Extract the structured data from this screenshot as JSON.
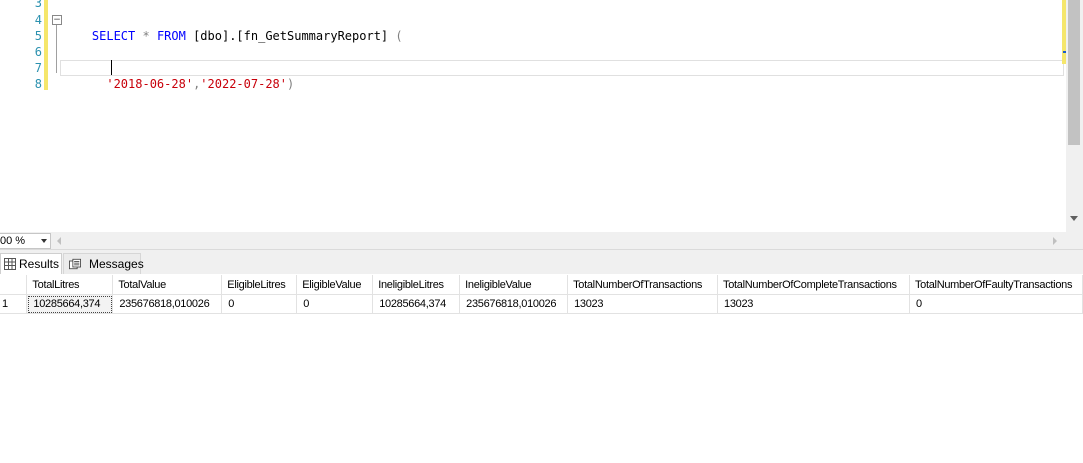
{
  "editor": {
    "line_numbers": [
      "3",
      "4",
      "5",
      "6",
      "7",
      "8"
    ],
    "collapse_glyph": "−",
    "line4": {
      "kw_select": "SELECT",
      "star": " * ",
      "kw_from": "FROM",
      "object": " [dbo].[fn_GetSummaryReport] ",
      "paren": "("
    },
    "line7": {
      "indent": "  ",
      "arg1": "'2018-06-28'",
      "comma": ",",
      "arg2": "'2022-07-28'",
      "close": ")"
    }
  },
  "zoom": {
    "value": "00 %"
  },
  "tabs": {
    "results": "Results",
    "messages": "Messages"
  },
  "results": {
    "columns": [
      "",
      "TotalLitres",
      "TotalValue",
      "EligibleLitres",
      "EligibleValue",
      "IneligibleLitres",
      "IneligibleValue",
      "TotalNumberOfTransactions",
      "TotalNumberOfCompleteTransactions",
      "TotalNumberOfFaultyTransactions"
    ],
    "rows": [
      [
        "1",
        "10285664,374",
        "235676818,010026",
        "0",
        "0",
        "10285664,374",
        "235676818,010026",
        "13023",
        "13023",
        "0"
      ]
    ]
  }
}
